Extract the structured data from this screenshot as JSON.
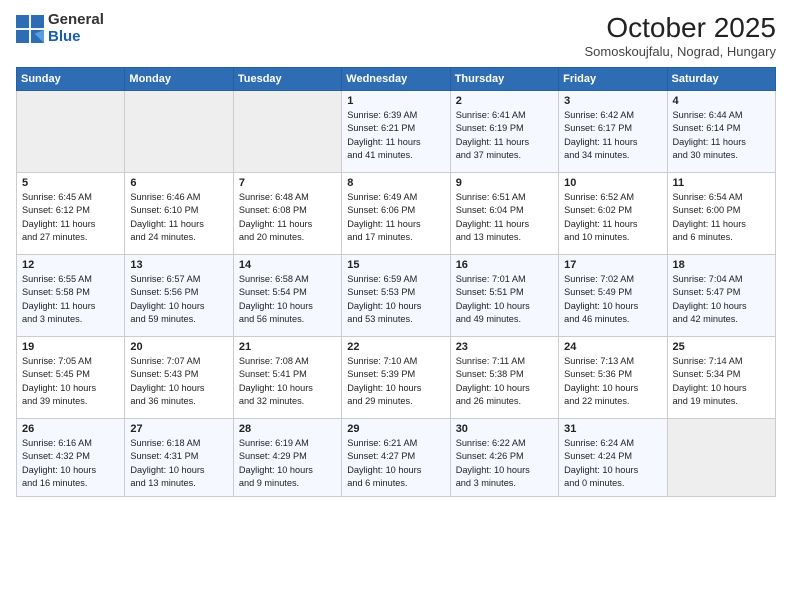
{
  "header": {
    "logo_general": "General",
    "logo_blue": "Blue",
    "month": "October 2025",
    "location": "Somoskoujfalu, Nograd, Hungary"
  },
  "days_of_week": [
    "Sunday",
    "Monday",
    "Tuesday",
    "Wednesday",
    "Thursday",
    "Friday",
    "Saturday"
  ],
  "weeks": [
    [
      {
        "day": "",
        "content": ""
      },
      {
        "day": "",
        "content": ""
      },
      {
        "day": "",
        "content": ""
      },
      {
        "day": "1",
        "content": "Sunrise: 6:39 AM\nSunset: 6:21 PM\nDaylight: 11 hours\nand 41 minutes."
      },
      {
        "day": "2",
        "content": "Sunrise: 6:41 AM\nSunset: 6:19 PM\nDaylight: 11 hours\nand 37 minutes."
      },
      {
        "day": "3",
        "content": "Sunrise: 6:42 AM\nSunset: 6:17 PM\nDaylight: 11 hours\nand 34 minutes."
      },
      {
        "day": "4",
        "content": "Sunrise: 6:44 AM\nSunset: 6:14 PM\nDaylight: 11 hours\nand 30 minutes."
      }
    ],
    [
      {
        "day": "5",
        "content": "Sunrise: 6:45 AM\nSunset: 6:12 PM\nDaylight: 11 hours\nand 27 minutes."
      },
      {
        "day": "6",
        "content": "Sunrise: 6:46 AM\nSunset: 6:10 PM\nDaylight: 11 hours\nand 24 minutes."
      },
      {
        "day": "7",
        "content": "Sunrise: 6:48 AM\nSunset: 6:08 PM\nDaylight: 11 hours\nand 20 minutes."
      },
      {
        "day": "8",
        "content": "Sunrise: 6:49 AM\nSunset: 6:06 PM\nDaylight: 11 hours\nand 17 minutes."
      },
      {
        "day": "9",
        "content": "Sunrise: 6:51 AM\nSunset: 6:04 PM\nDaylight: 11 hours\nand 13 minutes."
      },
      {
        "day": "10",
        "content": "Sunrise: 6:52 AM\nSunset: 6:02 PM\nDaylight: 11 hours\nand 10 minutes."
      },
      {
        "day": "11",
        "content": "Sunrise: 6:54 AM\nSunset: 6:00 PM\nDaylight: 11 hours\nand 6 minutes."
      }
    ],
    [
      {
        "day": "12",
        "content": "Sunrise: 6:55 AM\nSunset: 5:58 PM\nDaylight: 11 hours\nand 3 minutes."
      },
      {
        "day": "13",
        "content": "Sunrise: 6:57 AM\nSunset: 5:56 PM\nDaylight: 10 hours\nand 59 minutes."
      },
      {
        "day": "14",
        "content": "Sunrise: 6:58 AM\nSunset: 5:54 PM\nDaylight: 10 hours\nand 56 minutes."
      },
      {
        "day": "15",
        "content": "Sunrise: 6:59 AM\nSunset: 5:53 PM\nDaylight: 10 hours\nand 53 minutes."
      },
      {
        "day": "16",
        "content": "Sunrise: 7:01 AM\nSunset: 5:51 PM\nDaylight: 10 hours\nand 49 minutes."
      },
      {
        "day": "17",
        "content": "Sunrise: 7:02 AM\nSunset: 5:49 PM\nDaylight: 10 hours\nand 46 minutes."
      },
      {
        "day": "18",
        "content": "Sunrise: 7:04 AM\nSunset: 5:47 PM\nDaylight: 10 hours\nand 42 minutes."
      }
    ],
    [
      {
        "day": "19",
        "content": "Sunrise: 7:05 AM\nSunset: 5:45 PM\nDaylight: 10 hours\nand 39 minutes."
      },
      {
        "day": "20",
        "content": "Sunrise: 7:07 AM\nSunset: 5:43 PM\nDaylight: 10 hours\nand 36 minutes."
      },
      {
        "day": "21",
        "content": "Sunrise: 7:08 AM\nSunset: 5:41 PM\nDaylight: 10 hours\nand 32 minutes."
      },
      {
        "day": "22",
        "content": "Sunrise: 7:10 AM\nSunset: 5:39 PM\nDaylight: 10 hours\nand 29 minutes."
      },
      {
        "day": "23",
        "content": "Sunrise: 7:11 AM\nSunset: 5:38 PM\nDaylight: 10 hours\nand 26 minutes."
      },
      {
        "day": "24",
        "content": "Sunrise: 7:13 AM\nSunset: 5:36 PM\nDaylight: 10 hours\nand 22 minutes."
      },
      {
        "day": "25",
        "content": "Sunrise: 7:14 AM\nSunset: 5:34 PM\nDaylight: 10 hours\nand 19 minutes."
      }
    ],
    [
      {
        "day": "26",
        "content": "Sunrise: 6:16 AM\nSunset: 4:32 PM\nDaylight: 10 hours\nand 16 minutes."
      },
      {
        "day": "27",
        "content": "Sunrise: 6:18 AM\nSunset: 4:31 PM\nDaylight: 10 hours\nand 13 minutes."
      },
      {
        "day": "28",
        "content": "Sunrise: 6:19 AM\nSunset: 4:29 PM\nDaylight: 10 hours\nand 9 minutes."
      },
      {
        "day": "29",
        "content": "Sunrise: 6:21 AM\nSunset: 4:27 PM\nDaylight: 10 hours\nand 6 minutes."
      },
      {
        "day": "30",
        "content": "Sunrise: 6:22 AM\nSunset: 4:26 PM\nDaylight: 10 hours\nand 3 minutes."
      },
      {
        "day": "31",
        "content": "Sunrise: 6:24 AM\nSunset: 4:24 PM\nDaylight: 10 hours\nand 0 minutes."
      },
      {
        "day": "",
        "content": ""
      }
    ]
  ]
}
